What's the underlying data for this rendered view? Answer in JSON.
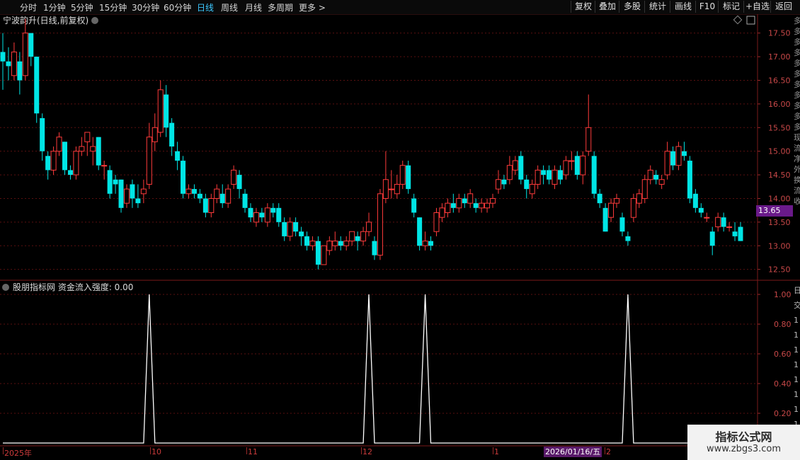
{
  "toolbar": {
    "timeframes": [
      "分时",
      "1分钟",
      "5分钟",
      "15分钟",
      "30分钟",
      "60分钟",
      "日线",
      "周线",
      "月线",
      "多周期",
      "更多 >"
    ],
    "active_timeframe": "日线",
    "right_buttons": [
      "复权",
      "叠加",
      "多股",
      "统计",
      "画线",
      "F10",
      "标记",
      "+自选",
      "返回"
    ]
  },
  "main_chart": {
    "title": "宁波韵升(日线,前复权)",
    "price_axis": [
      "17.50",
      "17.00",
      "16.50",
      "16.00",
      "15.50",
      "15.00",
      "14.50",
      "14.00",
      "13.50",
      "13.00",
      "12.50"
    ],
    "current_price": "13.65"
  },
  "indicator": {
    "title": "股朋指标网 资金流入强度: 0.00",
    "axis": [
      "1.00",
      "0.80",
      "0.60",
      "0.40",
      "0.20"
    ]
  },
  "date_axis": {
    "labels": [
      "2025年",
      "10",
      "11",
      "12",
      "1",
      "2"
    ],
    "cursor_date": "2026/01/16/五"
  },
  "watermark": {
    "line1": "指标公式网",
    "line2": "www.zbgs3.com"
  },
  "colors": {
    "up": "#ff3b3b",
    "down": "#00e5e5",
    "grid": "#5a1010",
    "axis_text": "#c84848",
    "indicator_line": "#ffffff"
  },
  "chart_data": {
    "type": "candlestick",
    "ylim": [
      12.3,
      17.9
    ],
    "candles": [
      {
        "o": 17.1,
        "c": 16.9,
        "h": 17.5,
        "l": 16.3
      },
      {
        "o": 16.9,
        "c": 16.8,
        "h": 17.2,
        "l": 16.5
      },
      {
        "o": 16.6,
        "c": 17.1,
        "h": 17.3,
        "l": 16.5
      },
      {
        "o": 16.9,
        "c": 16.5,
        "h": 17.1,
        "l": 16.2
      },
      {
        "o": 16.6,
        "c": 17.5,
        "h": 17.8,
        "l": 16.5
      },
      {
        "o": 17.5,
        "c": 17.0,
        "h": 17.5,
        "l": 16.8
      },
      {
        "o": 17.0,
        "c": 15.8,
        "h": 17.0,
        "l": 15.6
      },
      {
        "o": 15.7,
        "c": 15.0,
        "h": 15.8,
        "l": 14.8
      },
      {
        "o": 14.9,
        "c": 14.6,
        "h": 15.0,
        "l": 14.4
      },
      {
        "o": 14.6,
        "c": 15.0,
        "h": 15.1,
        "l": 14.5
      },
      {
        "o": 15.0,
        "c": 15.3,
        "h": 15.4,
        "l": 14.9
      },
      {
        "o": 15.2,
        "c": 14.6,
        "h": 15.2,
        "l": 14.5
      },
      {
        "o": 14.6,
        "c": 14.5,
        "h": 14.7,
        "l": 14.4
      },
      {
        "o": 14.5,
        "c": 15.0,
        "h": 15.1,
        "l": 14.4
      },
      {
        "o": 15.0,
        "c": 15.1,
        "h": 15.3,
        "l": 14.9
      },
      {
        "o": 15.2,
        "c": 15.4,
        "h": 15.4,
        "l": 14.9
      },
      {
        "o": 15.0,
        "c": 15.1,
        "h": 15.3,
        "l": 14.7
      },
      {
        "o": 15.3,
        "c": 14.7,
        "h": 15.3,
        "l": 14.6
      },
      {
        "o": 14.7,
        "c": 14.7,
        "h": 14.8,
        "l": 14.4
      },
      {
        "o": 14.6,
        "c": 14.1,
        "h": 14.7,
        "l": 14.0
      },
      {
        "o": 14.4,
        "c": 14.3,
        "h": 14.5,
        "l": 14.1
      },
      {
        "o": 14.4,
        "c": 13.8,
        "h": 14.4,
        "l": 13.7
      },
      {
        "o": 13.9,
        "c": 14.2,
        "h": 14.3,
        "l": 13.8
      },
      {
        "o": 14.3,
        "c": 14.0,
        "h": 14.4,
        "l": 13.8
      },
      {
        "o": 14.0,
        "c": 13.9,
        "h": 14.3,
        "l": 13.8
      },
      {
        "o": 14.1,
        "c": 14.2,
        "h": 14.4,
        "l": 13.9
      },
      {
        "o": 14.3,
        "c": 15.3,
        "h": 15.6,
        "l": 14.2
      },
      {
        "o": 15.2,
        "c": 15.5,
        "h": 15.8,
        "l": 15.0
      },
      {
        "o": 15.4,
        "c": 16.3,
        "h": 16.5,
        "l": 15.3
      },
      {
        "o": 16.2,
        "c": 15.5,
        "h": 16.4,
        "l": 15.3
      },
      {
        "o": 15.6,
        "c": 15.1,
        "h": 15.7,
        "l": 14.9
      },
      {
        "o": 15.0,
        "c": 14.8,
        "h": 15.2,
        "l": 14.6
      },
      {
        "o": 14.8,
        "c": 14.1,
        "h": 14.9,
        "l": 14.0
      },
      {
        "o": 14.1,
        "c": 14.2,
        "h": 14.3,
        "l": 14.0
      },
      {
        "o": 14.2,
        "c": 14.1,
        "h": 14.3,
        "l": 14.0
      },
      {
        "o": 14.1,
        "c": 14.0,
        "h": 14.2,
        "l": 13.9
      },
      {
        "o": 14.0,
        "c": 13.7,
        "h": 14.1,
        "l": 13.6
      },
      {
        "o": 13.7,
        "c": 14.0,
        "h": 14.1,
        "l": 13.6
      },
      {
        "o": 14.0,
        "c": 14.2,
        "h": 14.3,
        "l": 13.9
      },
      {
        "o": 14.1,
        "c": 13.9,
        "h": 14.3,
        "l": 13.8
      },
      {
        "o": 13.9,
        "c": 14.2,
        "h": 14.3,
        "l": 13.8
      },
      {
        "o": 14.3,
        "c": 14.6,
        "h": 14.7,
        "l": 14.2
      },
      {
        "o": 14.5,
        "c": 14.2,
        "h": 14.6,
        "l": 14.0
      },
      {
        "o": 14.1,
        "c": 13.8,
        "h": 14.2,
        "l": 13.7
      },
      {
        "o": 13.8,
        "c": 13.6,
        "h": 13.9,
        "l": 13.5
      },
      {
        "o": 13.5,
        "c": 13.7,
        "h": 13.8,
        "l": 13.4
      },
      {
        "o": 13.7,
        "c": 13.6,
        "h": 13.8,
        "l": 13.5
      },
      {
        "o": 13.5,
        "c": 13.8,
        "h": 13.9,
        "l": 13.4
      },
      {
        "o": 13.8,
        "c": 13.7,
        "h": 13.9,
        "l": 13.6
      },
      {
        "o": 13.8,
        "c": 13.5,
        "h": 13.9,
        "l": 13.4
      },
      {
        "o": 13.5,
        "c": 13.2,
        "h": 13.6,
        "l": 13.1
      },
      {
        "o": 13.2,
        "c": 13.5,
        "h": 13.6,
        "l": 13.1
      },
      {
        "o": 13.5,
        "c": 13.3,
        "h": 13.6,
        "l": 13.2
      },
      {
        "o": 13.3,
        "c": 13.2,
        "h": 13.4,
        "l": 13.0
      },
      {
        "o": 13.2,
        "c": 13.0,
        "h": 13.3,
        "l": 12.9
      },
      {
        "o": 13.0,
        "c": 13.1,
        "h": 13.2,
        "l": 12.9
      },
      {
        "o": 13.1,
        "c": 12.6,
        "h": 13.2,
        "l": 12.5
      },
      {
        "o": 12.6,
        "c": 13.0,
        "h": 13.0,
        "l": 12.6
      },
      {
        "o": 12.9,
        "c": 13.1,
        "h": 13.2,
        "l": 12.8
      },
      {
        "o": 13.0,
        "c": 13.1,
        "h": 13.3,
        "l": 12.9
      },
      {
        "o": 13.1,
        "c": 13.0,
        "h": 13.2,
        "l": 12.9
      },
      {
        "o": 13.0,
        "c": 13.1,
        "h": 13.2,
        "l": 12.9
      },
      {
        "o": 13.1,
        "c": 13.3,
        "h": 13.3,
        "l": 13.0
      },
      {
        "o": 13.2,
        "c": 13.1,
        "h": 13.3,
        "l": 12.9
      },
      {
        "o": 13.1,
        "c": 13.3,
        "h": 13.4,
        "l": 13.0
      },
      {
        "o": 13.3,
        "c": 13.5,
        "h": 13.7,
        "l": 13.2
      },
      {
        "o": 13.1,
        "c": 12.8,
        "h": 13.2,
        "l": 12.7
      },
      {
        "o": 12.8,
        "c": 14.1,
        "h": 14.2,
        "l": 12.7
      },
      {
        "o": 14.0,
        "c": 14.4,
        "h": 15.0,
        "l": 13.9
      },
      {
        "o": 14.2,
        "c": 14.2,
        "h": 14.6,
        "l": 14.0
      },
      {
        "o": 14.1,
        "c": 14.3,
        "h": 14.5,
        "l": 14.0
      },
      {
        "o": 14.3,
        "c": 14.7,
        "h": 14.8,
        "l": 14.2
      },
      {
        "o": 14.7,
        "c": 14.2,
        "h": 14.8,
        "l": 14.1
      },
      {
        "o": 14.0,
        "c": 13.7,
        "h": 14.1,
        "l": 13.6
      },
      {
        "o": 13.6,
        "c": 13.0,
        "h": 13.6,
        "l": 12.9
      },
      {
        "o": 13.0,
        "c": 13.1,
        "h": 13.3,
        "l": 12.9
      },
      {
        "o": 13.1,
        "c": 13.0,
        "h": 13.2,
        "l": 12.9
      },
      {
        "o": 13.3,
        "c": 13.7,
        "h": 13.8,
        "l": 13.2
      },
      {
        "o": 13.6,
        "c": 13.8,
        "h": 13.9,
        "l": 13.5
      },
      {
        "o": 13.7,
        "c": 13.9,
        "h": 14.0,
        "l": 13.6
      },
      {
        "o": 13.9,
        "c": 13.8,
        "h": 14.1,
        "l": 13.7
      },
      {
        "o": 13.8,
        "c": 14.0,
        "h": 14.1,
        "l": 13.7
      },
      {
        "o": 14.0,
        "c": 13.9,
        "h": 14.1,
        "l": 13.8
      },
      {
        "o": 13.9,
        "c": 14.1,
        "h": 14.2,
        "l": 13.8
      },
      {
        "o": 13.9,
        "c": 13.8,
        "h": 14.0,
        "l": 13.7
      },
      {
        "o": 13.8,
        "c": 13.9,
        "h": 14.0,
        "l": 13.7
      },
      {
        "o": 13.8,
        "c": 13.9,
        "h": 14.0,
        "l": 13.7
      },
      {
        "o": 13.9,
        "c": 14.0,
        "h": 14.1,
        "l": 13.8
      },
      {
        "o": 14.2,
        "c": 14.4,
        "h": 14.6,
        "l": 14.1
      },
      {
        "o": 14.4,
        "c": 14.3,
        "h": 14.5,
        "l": 14.2
      },
      {
        "o": 14.4,
        "c": 14.7,
        "h": 14.9,
        "l": 14.3
      },
      {
        "o": 14.6,
        "c": 14.8,
        "h": 14.9,
        "l": 14.5
      },
      {
        "o": 14.9,
        "c": 14.4,
        "h": 15.0,
        "l": 14.3
      },
      {
        "o": 14.4,
        "c": 14.2,
        "h": 14.5,
        "l": 14.0
      },
      {
        "o": 14.1,
        "c": 14.3,
        "h": 14.4,
        "l": 14.0
      },
      {
        "o": 14.3,
        "c": 14.6,
        "h": 14.7,
        "l": 14.2
      },
      {
        "o": 14.6,
        "c": 14.5,
        "h": 14.7,
        "l": 14.3
      },
      {
        "o": 14.6,
        "c": 14.4,
        "h": 14.7,
        "l": 14.3
      },
      {
        "o": 14.3,
        "c": 14.6,
        "h": 14.7,
        "l": 14.2
      },
      {
        "o": 14.6,
        "c": 14.4,
        "h": 14.7,
        "l": 14.3
      },
      {
        "o": 14.5,
        "c": 14.8,
        "h": 14.9,
        "l": 14.4
      },
      {
        "o": 14.8,
        "c": 14.8,
        "h": 15.0,
        "l": 14.6
      },
      {
        "o": 14.9,
        "c": 14.5,
        "h": 15.0,
        "l": 14.4
      },
      {
        "o": 14.5,
        "c": 14.9,
        "h": 15.0,
        "l": 14.3
      },
      {
        "o": 15.0,
        "c": 15.5,
        "h": 16.2,
        "l": 14.9
      },
      {
        "o": 14.9,
        "c": 14.1,
        "h": 15.0,
        "l": 14.0
      },
      {
        "o": 14.1,
        "c": 13.9,
        "h": 14.2,
        "l": 13.8
      },
      {
        "o": 13.8,
        "c": 13.3,
        "h": 13.9,
        "l": 13.3
      },
      {
        "o": 13.6,
        "c": 13.9,
        "h": 14.0,
        "l": 13.5
      },
      {
        "o": 13.9,
        "c": 14.0,
        "h": 14.1,
        "l": 13.8
      },
      {
        "o": 13.6,
        "c": 13.3,
        "h": 13.7,
        "l": 13.2
      },
      {
        "o": 13.2,
        "c": 13.1,
        "h": 13.3,
        "l": 13.0
      },
      {
        "o": 13.6,
        "c": 14.0,
        "h": 14.1,
        "l": 13.5
      },
      {
        "o": 13.9,
        "c": 14.1,
        "h": 14.2,
        "l": 13.8
      },
      {
        "o": 14.0,
        "c": 14.4,
        "h": 14.5,
        "l": 13.9
      },
      {
        "o": 14.4,
        "c": 14.6,
        "h": 14.7,
        "l": 14.3
      },
      {
        "o": 14.5,
        "c": 14.4,
        "h": 14.6,
        "l": 14.3
      },
      {
        "o": 14.3,
        "c": 14.4,
        "h": 14.5,
        "l": 14.2
      },
      {
        "o": 14.5,
        "c": 15.0,
        "h": 15.2,
        "l": 14.4
      },
      {
        "o": 15.0,
        "c": 14.7,
        "h": 15.1,
        "l": 14.6
      },
      {
        "o": 14.7,
        "c": 15.1,
        "h": 15.2,
        "l": 14.6
      },
      {
        "o": 15.0,
        "c": 14.9,
        "h": 15.2,
        "l": 14.8
      },
      {
        "o": 14.8,
        "c": 14.0,
        "h": 14.9,
        "l": 13.9
      },
      {
        "o": 14.1,
        "c": 13.8,
        "h": 14.2,
        "l": 13.7
      },
      {
        "o": 13.8,
        "c": 13.7,
        "h": 13.9,
        "l": 13.6
      },
      {
        "o": 13.6,
        "c": 13.6,
        "h": 13.7,
        "l": 13.5
      },
      {
        "o": 13.3,
        "c": 13.0,
        "h": 13.4,
        "l": 12.8
      },
      {
        "o": 13.4,
        "c": 13.6,
        "h": 13.7,
        "l": 13.3
      },
      {
        "o": 13.6,
        "c": 13.4,
        "h": 13.7,
        "l": 13.3
      },
      {
        "o": 13.4,
        "c": 13.4,
        "h": 13.5,
        "l": 13.3
      },
      {
        "o": 13.3,
        "c": 13.2,
        "h": 13.5,
        "l": 13.1
      },
      {
        "o": 13.4,
        "c": 13.1,
        "h": 13.5,
        "l": 13.1
      }
    ],
    "indicator_series": {
      "name": "资金流入强度",
      "peaks_at_candle": [
        26,
        65,
        75,
        111
      ],
      "value_other": 0.0,
      "value_peak": 1.0
    }
  }
}
